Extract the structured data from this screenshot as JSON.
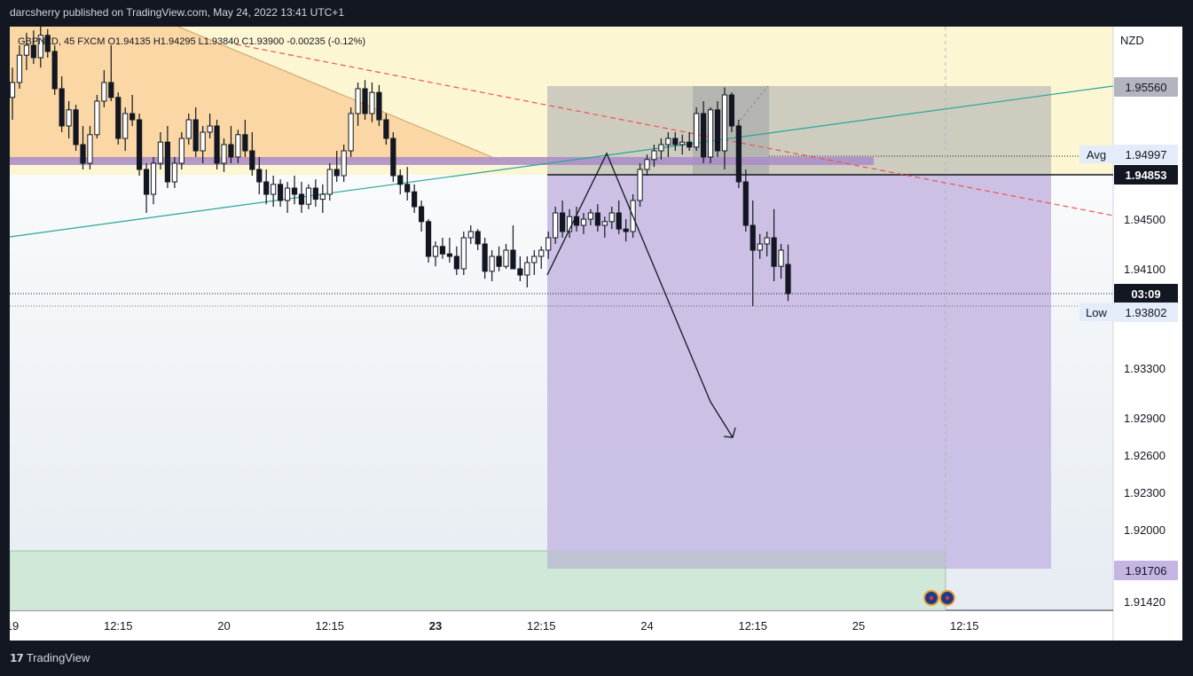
{
  "header": {
    "publisher_text": "darcsherry published on TradingView.com, May 24, 2022 13:41 UTC+1"
  },
  "footer": {
    "brand": "TradingView",
    "logo_icon": "tradingview-logo-icon"
  },
  "chart_data": {
    "type": "candlestick",
    "symbol": "GBPNZD, 45, FXCM",
    "legend": {
      "symbol": "GBPNZD, 45",
      "source": "FXCM",
      "open": "O1.94135",
      "high": "H1.94295",
      "low": "L1.93840",
      "close": "C1.93900",
      "change": "-0.00235 (-0.12%)"
    },
    "currency": "NZD",
    "ylim": [
      1.9135,
      1.9605
    ],
    "y_ticks": [
      "1.94500",
      "1.94100",
      "1.93300",
      "1.92900",
      "1.92600",
      "1.92300",
      "1.92000",
      "1.91420"
    ],
    "x_ticks": [
      {
        "label": "19",
        "bold": false,
        "bar": 0
      },
      {
        "label": "12:15",
        "bold": false,
        "bar": 15
      },
      {
        "label": "20",
        "bold": false,
        "bar": 30
      },
      {
        "label": "12:15",
        "bold": false,
        "bar": 45
      },
      {
        "label": "23",
        "bold": true,
        "bar": 60
      },
      {
        "label": "12:15",
        "bold": false,
        "bar": 75
      },
      {
        "label": "24",
        "bold": false,
        "bar": 90
      },
      {
        "label": "12:15",
        "bold": false,
        "bar": 105
      },
      {
        "label": "25",
        "bold": false,
        "bar": 120
      },
      {
        "label": "12:15",
        "bold": false,
        "bar": 135
      }
    ],
    "price_tags": [
      {
        "label": "",
        "value": "1.95560",
        "price": 1.9556,
        "bg": "#b2b5be",
        "fg": "#131722"
      },
      {
        "label": "Avg",
        "value": "1.94997",
        "price": 1.94997,
        "bg": "#e3ecf8",
        "fg": "#131722"
      },
      {
        "label": "",
        "value": "1.94853",
        "price": 1.94853,
        "bg": "#131722",
        "fg": "#ffffff"
      },
      {
        "label": "",
        "value": "03:09",
        "price": 1.939,
        "bg": "#131722",
        "fg": "#ffffff"
      },
      {
        "label": "Low",
        "value": "1.93802",
        "price": 1.93802,
        "bg": "#e3ecf8",
        "fg": "#131722"
      },
      {
        "label": "",
        "value": "1.91706",
        "price": 1.91706,
        "bg": "#c4b5e3",
        "fg": "#131722"
      }
    ],
    "candles": [
      [
        1.9548,
        1.9572,
        1.953,
        1.956
      ],
      [
        1.956,
        1.959,
        1.9555,
        1.9582
      ],
      [
        1.9582,
        1.96,
        1.957,
        1.959
      ],
      [
        1.959,
        1.9602,
        1.9575,
        1.958
      ],
      [
        1.958,
        1.9605,
        1.9572,
        1.9598
      ],
      [
        1.9598,
        1.9603,
        1.958,
        1.9585
      ],
      [
        1.9585,
        1.959,
        1.955,
        1.9555
      ],
      [
        1.9555,
        1.9565,
        1.952,
        1.9525
      ],
      [
        1.9525,
        1.9545,
        1.9515,
        1.9538
      ],
      [
        1.9538,
        1.9542,
        1.9505,
        1.951
      ],
      [
        1.951,
        1.9525,
        1.949,
        1.9495
      ],
      [
        1.9495,
        1.9525,
        1.949,
        1.9518
      ],
      [
        1.9518,
        1.955,
        1.9515,
        1.9545
      ],
      [
        1.9545,
        1.957,
        1.954,
        1.956
      ],
      [
        1.956,
        1.959,
        1.9545,
        1.9548
      ],
      [
        1.9548,
        1.9552,
        1.951,
        1.9515
      ],
      [
        1.9515,
        1.954,
        1.9505,
        1.9535
      ],
      [
        1.9535,
        1.955,
        1.9525,
        1.953
      ],
      [
        1.953,
        1.9535,
        1.9485,
        1.949
      ],
      [
        1.949,
        1.9495,
        1.9455,
        1.947
      ],
      [
        1.947,
        1.95,
        1.9462,
        1.9495
      ],
      [
        1.9495,
        1.952,
        1.949,
        1.9512
      ],
      [
        1.9512,
        1.9525,
        1.9475,
        1.948
      ],
      [
        1.948,
        1.95,
        1.9475,
        1.9495
      ],
      [
        1.9495,
        1.952,
        1.949,
        1.9515
      ],
      [
        1.9515,
        1.9535,
        1.951,
        1.953
      ],
      [
        1.953,
        1.954,
        1.95,
        1.9505
      ],
      [
        1.9505,
        1.9525,
        1.9495,
        1.952
      ],
      [
        1.952,
        1.9535,
        1.9515,
        1.9525
      ],
      [
        1.9525,
        1.953,
        1.949,
        1.9495
      ],
      [
        1.9495,
        1.9515,
        1.9488,
        1.951
      ],
      [
        1.951,
        1.9525,
        1.9495,
        1.95
      ],
      [
        1.95,
        1.9522,
        1.9495,
        1.9518
      ],
      [
        1.9518,
        1.953,
        1.95,
        1.9505
      ],
      [
        1.9505,
        1.952,
        1.9485,
        1.949
      ],
      [
        1.949,
        1.95,
        1.947,
        1.948
      ],
      [
        1.948,
        1.949,
        1.9462,
        1.947
      ],
      [
        1.947,
        1.9485,
        1.946,
        1.9478
      ],
      [
        1.9478,
        1.9482,
        1.946,
        1.9465
      ],
      [
        1.9465,
        1.948,
        1.9455,
        1.9475
      ],
      [
        1.9475,
        1.9485,
        1.9462,
        1.947
      ],
      [
        1.947,
        1.948,
        1.9455,
        1.9462
      ],
      [
        1.9462,
        1.9478,
        1.9458,
        1.9475
      ],
      [
        1.9475,
        1.9482,
        1.946,
        1.9466
      ],
      [
        1.9466,
        1.9478,
        1.9455,
        1.947
      ],
      [
        1.947,
        1.9495,
        1.9465,
        1.949
      ],
      [
        1.949,
        1.9505,
        1.948,
        1.9485
      ],
      [
        1.9485,
        1.951,
        1.948,
        1.9505
      ],
      [
        1.9505,
        1.954,
        1.95,
        1.9535
      ],
      [
        1.9535,
        1.956,
        1.9525,
        1.9555
      ],
      [
        1.9555,
        1.9562,
        1.953,
        1.9535
      ],
      [
        1.9535,
        1.956,
        1.9528,
        1.9552
      ],
      [
        1.9552,
        1.9558,
        1.9525,
        1.953
      ],
      [
        1.953,
        1.9535,
        1.951,
        1.9515
      ],
      [
        1.9515,
        1.952,
        1.948,
        1.9485
      ],
      [
        1.9485,
        1.949,
        1.947,
        1.9478
      ],
      [
        1.9478,
        1.9492,
        1.9465,
        1.9472
      ],
      [
        1.9472,
        1.9478,
        1.9455,
        1.946
      ],
      [
        1.946,
        1.9465,
        1.944,
        1.9448
      ],
      [
        1.9448,
        1.945,
        1.9415,
        1.942
      ],
      [
        1.942,
        1.9432,
        1.9412,
        1.9428
      ],
      [
        1.9428,
        1.9435,
        1.9418,
        1.9422
      ],
      [
        1.9422,
        1.9435,
        1.9415,
        1.942
      ],
      [
        1.942,
        1.9428,
        1.9405,
        1.941
      ],
      [
        1.941,
        1.944,
        1.9405,
        1.9435
      ],
      [
        1.9435,
        1.9445,
        1.943,
        1.944
      ],
      [
        1.944,
        1.9442,
        1.9425,
        1.943
      ],
      [
        1.943,
        1.9435,
        1.9402,
        1.9408
      ],
      [
        1.9408,
        1.9425,
        1.94,
        1.942
      ],
      [
        1.942,
        1.9428,
        1.9408,
        1.9412
      ],
      [
        1.9412,
        1.943,
        1.941,
        1.9425
      ],
      [
        1.9425,
        1.9445,
        1.942,
        1.941
      ],
      [
        1.941,
        1.942,
        1.94,
        1.9405
      ],
      [
        1.9405,
        1.942,
        1.9395,
        1.9415
      ],
      [
        1.9415,
        1.9425,
        1.9405,
        1.942
      ],
      [
        1.942,
        1.9428,
        1.941,
        1.9425
      ],
      [
        1.9425,
        1.944,
        1.9418,
        1.9435
      ],
      [
        1.9435,
        1.946,
        1.943,
        1.9455
      ],
      [
        1.9455,
        1.9465,
        1.9435,
        1.944
      ],
      [
        1.944,
        1.9458,
        1.9435,
        1.9452
      ],
      [
        1.9452,
        1.946,
        1.944,
        1.9445
      ],
      [
        1.9445,
        1.9455,
        1.9438,
        1.945
      ],
      [
        1.945,
        1.9458,
        1.9445,
        1.9455
      ],
      [
        1.9455,
        1.9462,
        1.944,
        1.9445
      ],
      [
        1.9445,
        1.9452,
        1.9435,
        1.9448
      ],
      [
        1.9448,
        1.946,
        1.9442,
        1.9455
      ],
      [
        1.9455,
        1.9465,
        1.9438,
        1.9442
      ],
      [
        1.9442,
        1.945,
        1.9432,
        1.944
      ],
      [
        1.944,
        1.947,
        1.9435,
        1.9465
      ],
      [
        1.9465,
        1.9495,
        1.946,
        1.949
      ],
      [
        1.949,
        1.9502,
        1.9485,
        1.9498
      ],
      [
        1.9498,
        1.951,
        1.9492,
        1.9505
      ],
      [
        1.9505,
        1.9515,
        1.9498,
        1.951
      ],
      [
        1.951,
        1.952,
        1.95,
        1.9515
      ],
      [
        1.9515,
        1.952,
        1.9505,
        1.951
      ],
      [
        1.951,
        1.9518,
        1.9502,
        1.9512
      ],
      [
        1.9512,
        1.952,
        1.9505,
        1.9508
      ],
      [
        1.9508,
        1.954,
        1.9505,
        1.9535
      ],
      [
        1.9535,
        1.9545,
        1.9495,
        1.95
      ],
      [
        1.95,
        1.954,
        1.9495,
        1.9538
      ],
      [
        1.9538,
        1.9545,
        1.95,
        1.9505
      ],
      [
        1.9505,
        1.9556,
        1.949,
        1.955
      ],
      [
        1.955,
        1.9552,
        1.952,
        1.9525
      ],
      [
        1.9525,
        1.953,
        1.9475,
        1.948
      ],
      [
        1.948,
        1.949,
        1.944,
        1.9445
      ],
      [
        1.9445,
        1.9465,
        1.938,
        1.9425
      ],
      [
        1.9425,
        1.9438,
        1.9418,
        1.943
      ],
      [
        1.943,
        1.944,
        1.942,
        1.9435
      ],
      [
        1.9435,
        1.9458,
        1.94,
        1.9412
      ],
      [
        1.9412,
        1.943,
        1.9402,
        1.9425
      ],
      [
        1.94135,
        1.94295,
        1.9384,
        1.939
      ]
    ]
  }
}
